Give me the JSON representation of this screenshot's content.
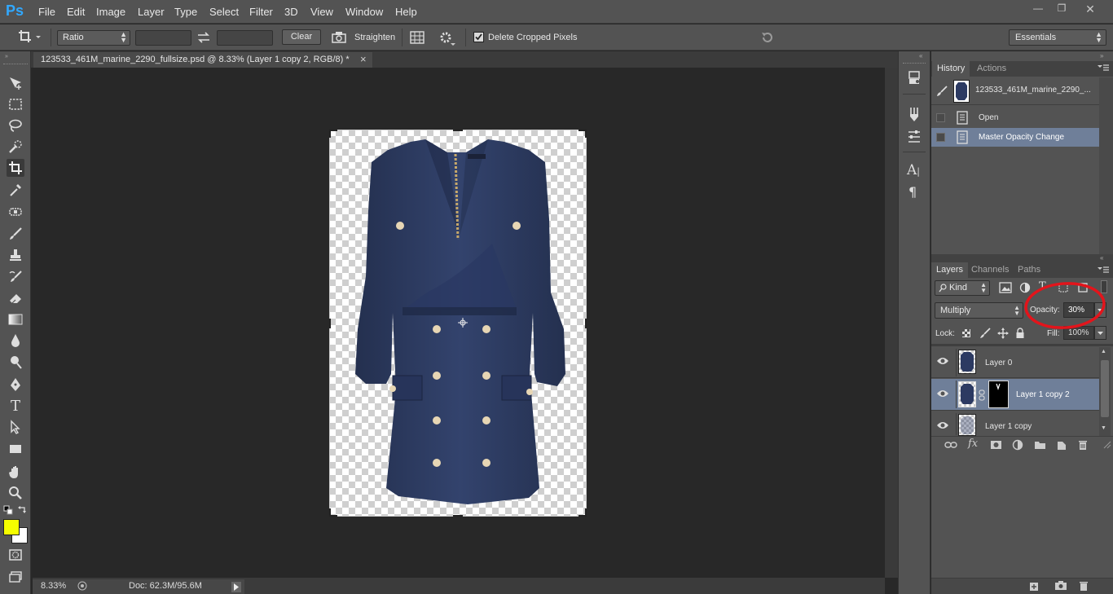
{
  "app": {
    "logo": "Ps"
  },
  "menu": [
    "File",
    "Edit",
    "Image",
    "Layer",
    "Type",
    "Select",
    "Filter",
    "3D",
    "View",
    "Window",
    "Help"
  ],
  "window_controls": {
    "minimize": "—",
    "restore": "❐",
    "close": "✕"
  },
  "options_bar": {
    "ratio_label": "Ratio",
    "clear_label": "Clear",
    "straighten_label": "Straighten",
    "delete_cropped_label": "Delete Cropped Pixels",
    "delete_cropped_checked": true,
    "workspace": "Essentials"
  },
  "document": {
    "tab_title": "123533_461M_marine_2290_fullsize.psd @ 8.33% (Layer 1 copy 2, RGB/8) *",
    "close_glyph": "×"
  },
  "status": {
    "zoom": "8.33%",
    "doc": "Doc: 62.3M/95.6M"
  },
  "history_panel": {
    "tabs": [
      "History",
      "Actions"
    ],
    "snapshot": "123533_461M_marine_2290_...",
    "items": [
      {
        "label": "Open",
        "selected": false
      },
      {
        "label": "Master Opacity Change",
        "selected": true
      }
    ]
  },
  "layers_panel": {
    "tabs": [
      "Layers",
      "Channels",
      "Paths"
    ],
    "filter_kind": "Kind",
    "blend_mode": "Multiply",
    "opacity_label": "Opacity:",
    "opacity_value": "30%",
    "lock_label": "Lock:",
    "fill_label": "Fill:",
    "fill_value": "100%",
    "layers": [
      {
        "name": "Layer 0",
        "selected": false,
        "has_mask": false
      },
      {
        "name": "Layer 1 copy 2",
        "selected": true,
        "has_mask": true
      },
      {
        "name": "Layer 1 copy",
        "selected": false,
        "has_mask": false
      }
    ],
    "footer_icons": [
      "link-icon",
      "fx-icon",
      "mask-icon",
      "adjustment-icon",
      "folder-icon",
      "new-layer-icon",
      "trash-icon"
    ]
  },
  "colors": {
    "foreground": "#f6ff00",
    "background": "#ffffff",
    "selected_row": "#6f7f99",
    "annotation": "#e3141b",
    "dress": "#2c3a62"
  },
  "tools": [
    "move-tool-icon",
    "marquee-tool-icon",
    "lasso-tool-icon",
    "quick-select-tool-icon",
    "crop-tool-icon",
    "eyedropper-tool-icon",
    "spot-heal-tool-icon",
    "brush-tool-icon",
    "stamp-tool-icon",
    "history-brush-tool-icon",
    "eraser-tool-icon",
    "gradient-tool-icon",
    "blur-tool-icon",
    "dodge-tool-icon",
    "pen-tool-icon",
    "type-tool-icon",
    "path-select-tool-icon",
    "rectangle-tool-icon",
    "hand-tool-icon",
    "zoom-tool-icon"
  ]
}
